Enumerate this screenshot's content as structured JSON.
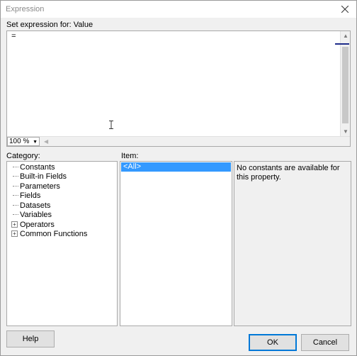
{
  "window": {
    "title": "Expression"
  },
  "editor": {
    "prompt": "Set expression for: Value",
    "content": "=",
    "zoom": "100 %"
  },
  "category": {
    "label": "Category:",
    "items": [
      {
        "label": "Constants",
        "expandable": false
      },
      {
        "label": "Built-in Fields",
        "expandable": false
      },
      {
        "label": "Parameters",
        "expandable": false
      },
      {
        "label": "Fields",
        "expandable": false
      },
      {
        "label": "Datasets",
        "expandable": false
      },
      {
        "label": "Variables",
        "expandable": false
      },
      {
        "label": "Operators",
        "expandable": true
      },
      {
        "label": "Common Functions",
        "expandable": true
      }
    ]
  },
  "item": {
    "label": "Item:",
    "selected": "<All>"
  },
  "description": {
    "text": "No constants are available for this property."
  },
  "buttons": {
    "help": "Help",
    "ok": "OK",
    "cancel": "Cancel"
  },
  "icons": {
    "close": "close-icon",
    "expand": "plus-box-icon",
    "scroll_up": "triangle-up-icon",
    "scroll_down": "triangle-down-icon",
    "cursor": "i-beam-cursor-icon"
  },
  "colors": {
    "selection": "#3399ff",
    "ok_border": "#0078d7"
  }
}
